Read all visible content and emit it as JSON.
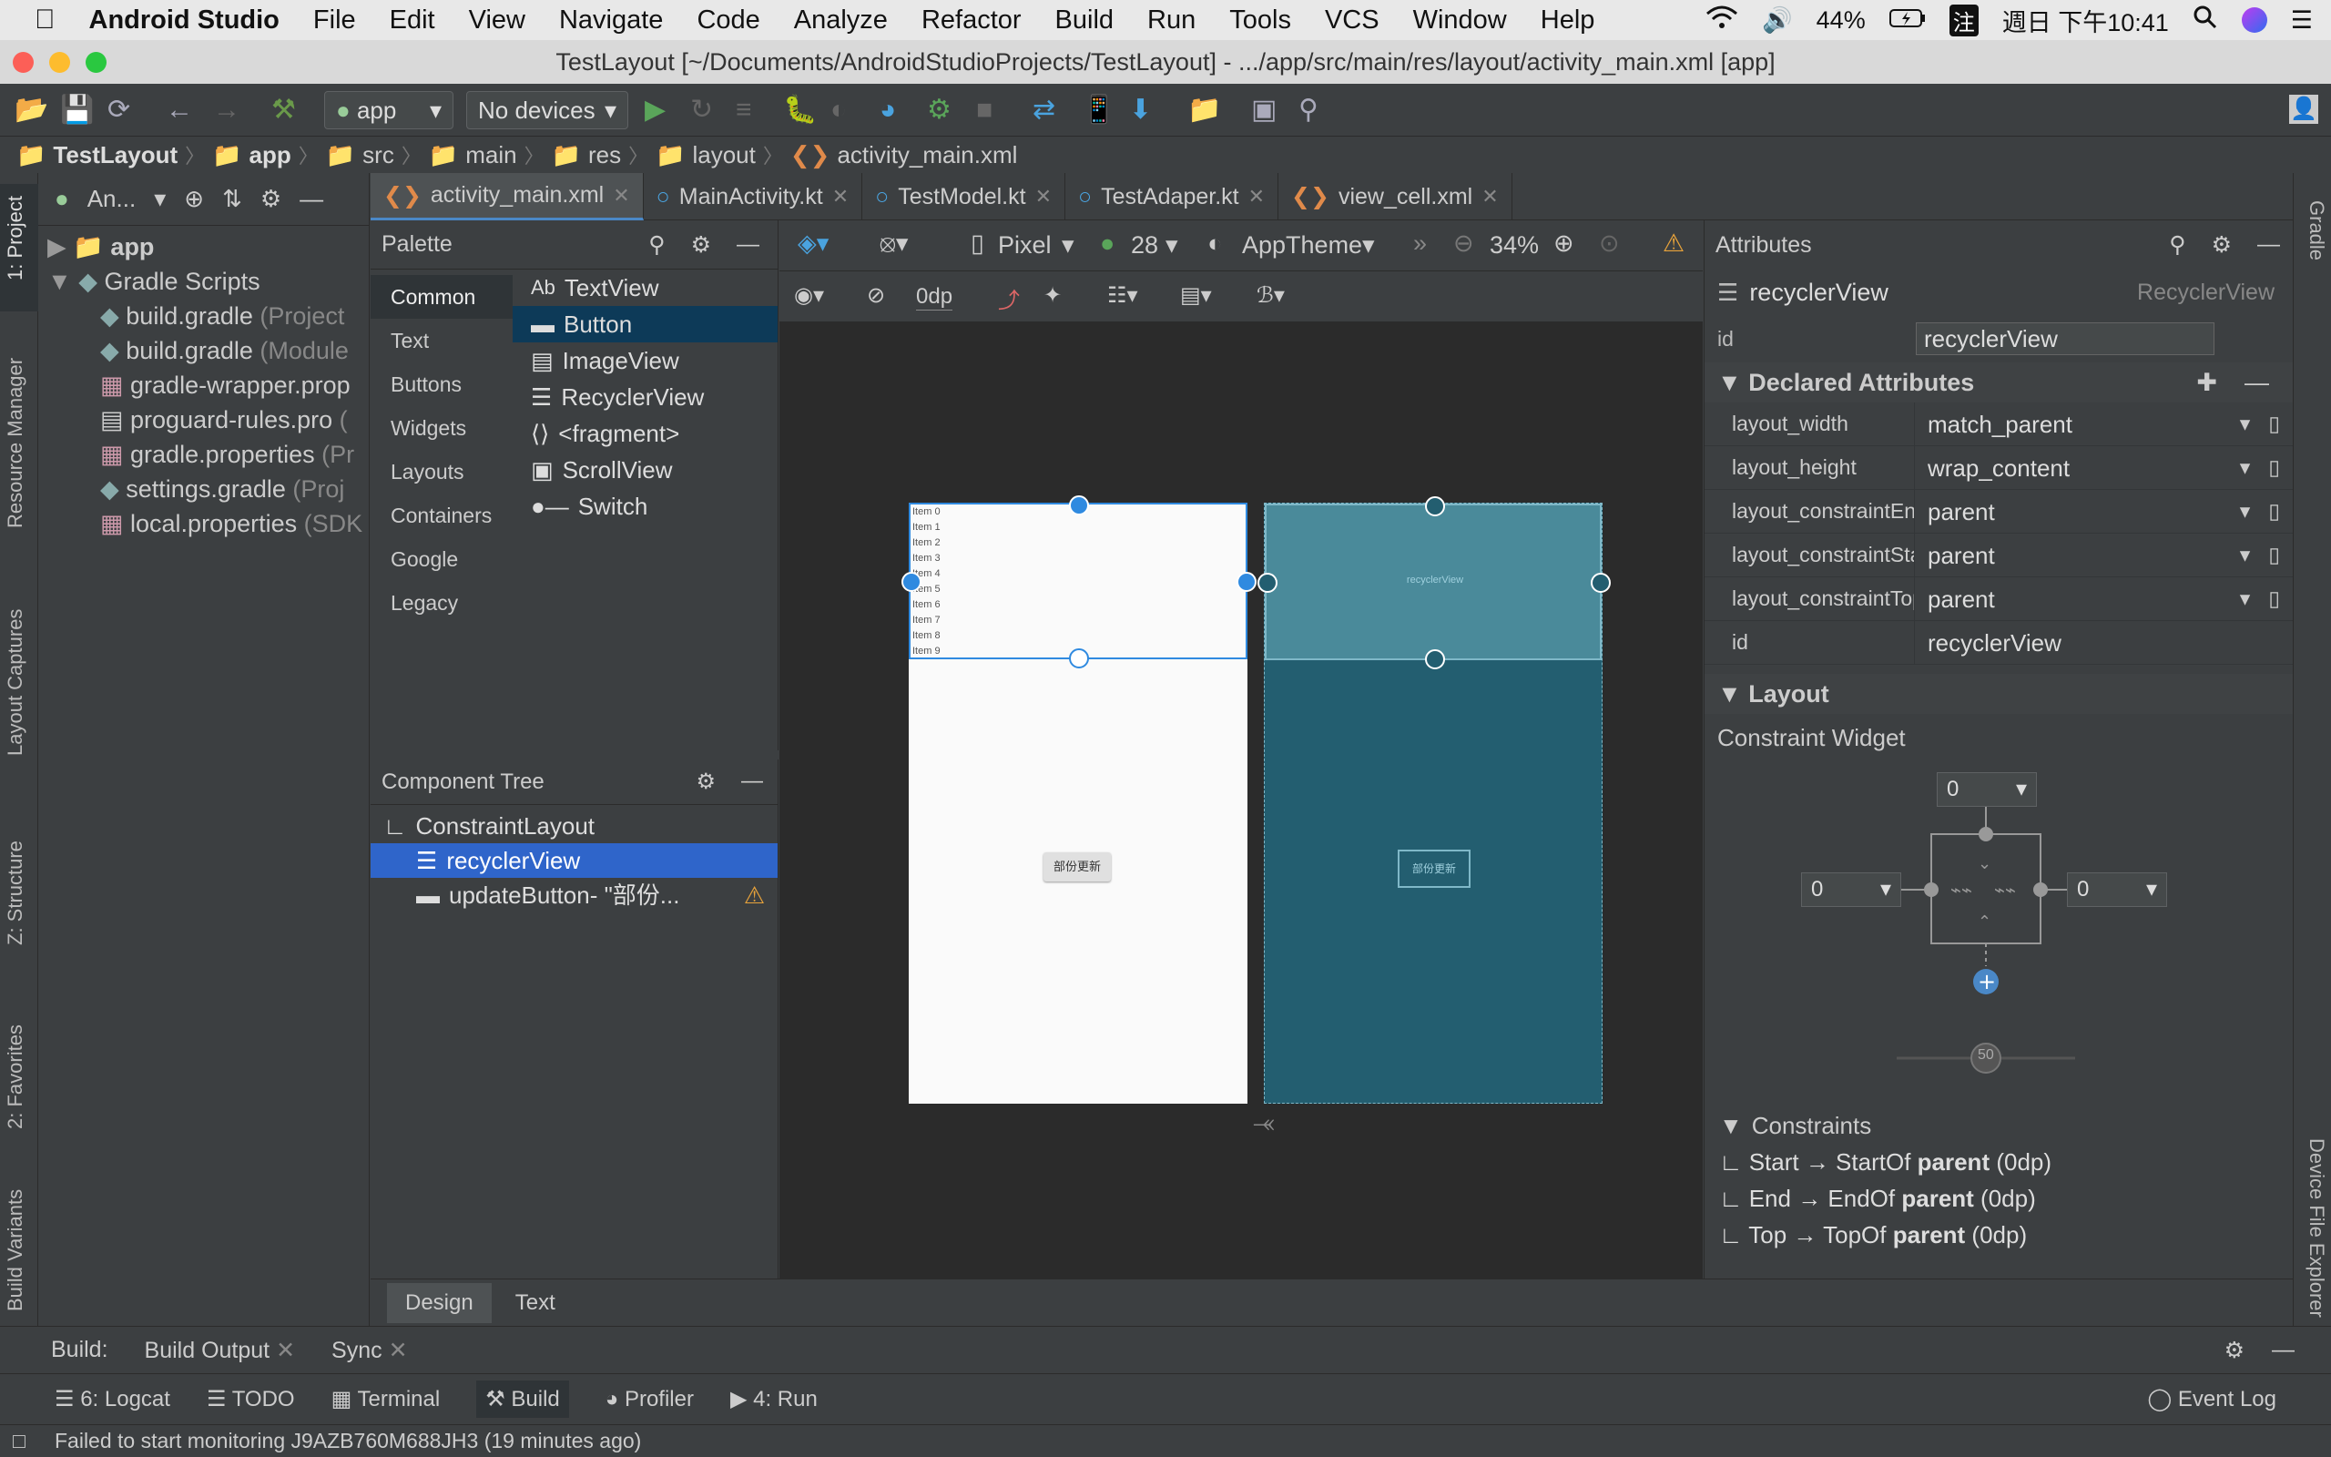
{
  "menubar": {
    "app": "Android Studio",
    "items": [
      "File",
      "Edit",
      "View",
      "Navigate",
      "Code",
      "Analyze",
      "Refactor",
      "Build",
      "Run",
      "Tools",
      "VCS",
      "Window",
      "Help"
    ],
    "battery": "44%",
    "ime": "注",
    "clock": "週日 下午10:41"
  },
  "window": {
    "title": "TestLayout [~/Documents/AndroidStudioProjects/TestLayout] - .../app/src/main/res/layout/activity_main.xml [app]"
  },
  "toolbar": {
    "config": "app",
    "device": "No devices"
  },
  "breadcrumb": [
    "TestLayout",
    "app",
    "src",
    "main",
    "res",
    "layout",
    "activity_main.xml"
  ],
  "left_strip": [
    "1: Project",
    "Resource Manager",
    "Layout Captures",
    "Z: Structure",
    "2: Favorites",
    "Build Variants"
  ],
  "right_strip": [
    "Gradle",
    "Device File Explorer"
  ],
  "project": {
    "view": "An...",
    "tree": [
      {
        "label": "app",
        "extra": "",
        "level": 0,
        "bold": true
      },
      {
        "label": "Gradle Scripts",
        "extra": "",
        "level": 0
      },
      {
        "label": "build.gradle",
        "extra": "(Project",
        "level": 1
      },
      {
        "label": "build.gradle",
        "extra": "(Module",
        "level": 1
      },
      {
        "label": "gradle-wrapper.prop",
        "extra": "",
        "level": 1
      },
      {
        "label": "proguard-rules.pro",
        "extra": "(",
        "level": 1
      },
      {
        "label": "gradle.properties",
        "extra": "(Pr",
        "level": 1
      },
      {
        "label": "settings.gradle",
        "extra": "(Proj",
        "level": 1
      },
      {
        "label": "local.properties",
        "extra": "(SDK",
        "level": 1
      }
    ]
  },
  "tabs": [
    "activity_main.xml",
    "MainActivity.kt",
    "TestModel.kt",
    "TestAdaper.kt",
    "view_cell.xml"
  ],
  "palette": {
    "title": "Palette",
    "categories": [
      "Common",
      "Text",
      "Buttons",
      "Widgets",
      "Layouts",
      "Containers",
      "Google",
      "Legacy"
    ],
    "items": [
      "TextView",
      "Button",
      "ImageView",
      "RecyclerView",
      "<fragment>",
      "ScrollView",
      "Switch"
    ]
  },
  "component_tree": {
    "title": "Component Tree",
    "items": [
      "ConstraintLayout",
      "recyclerView",
      "updateButton- \"部份..."
    ]
  },
  "design": {
    "device": "Pixel",
    "api": "28",
    "theme": "AppTheme",
    "zoom": "34%",
    "margin": "0dp",
    "list_items": [
      "Item 0",
      "Item 1",
      "Item 2",
      "Item 3",
      "Item 4",
      "Item 5",
      "Item 6",
      "Item 7",
      "Item 8",
      "Item 9"
    ],
    "button_text": "部份更新",
    "blueprint_label": "recyclerView",
    "tabs": [
      "Design",
      "Text"
    ]
  },
  "attributes": {
    "title": "Attributes",
    "component": "recyclerView",
    "type": "RecyclerView",
    "id": "recyclerView",
    "declared_title": "Declared Attributes",
    "declared": [
      {
        "k": "layout_width",
        "v": "match_parent"
      },
      {
        "k": "layout_height",
        "v": "wrap_content"
      },
      {
        "k": "layout_constraintEnd_",
        "v": "parent"
      },
      {
        "k": "layout_constraintStar",
        "v": "parent"
      },
      {
        "k": "layout_constraintTop_",
        "v": "parent"
      },
      {
        "k": "id",
        "v": "recyclerView"
      }
    ],
    "layout_title": "Layout",
    "constraint_widget": "Constraint Widget",
    "margin_top": "0",
    "margin_left": "0",
    "margin_right": "0",
    "bias": "50",
    "constraints_title": "Constraints",
    "constraints": [
      {
        "a": "Start → StartOf ",
        "b": "parent",
        "c": " (0dp)"
      },
      {
        "a": "End → EndOf ",
        "b": "parent",
        "c": " (0dp)"
      },
      {
        "a": "Top → TopOf ",
        "b": "parent",
        "c": " (0dp)"
      }
    ]
  },
  "bottom": {
    "build_label": "Build:",
    "build_tabs": [
      "Build Output",
      "Sync"
    ],
    "tool_windows": [
      "6: Logcat",
      "TODO",
      "Terminal",
      "Build",
      "Profiler",
      "4: Run"
    ],
    "event_log": "Event Log",
    "status": "Failed to start monitoring J9AZB760M688JH3 (19 minutes ago)"
  },
  "colors": {
    "accent": "#2f65ca",
    "blueprint": "#235e70",
    "blueprint_sel": "#4a8a9a",
    "handle": "#2f8ae0"
  }
}
